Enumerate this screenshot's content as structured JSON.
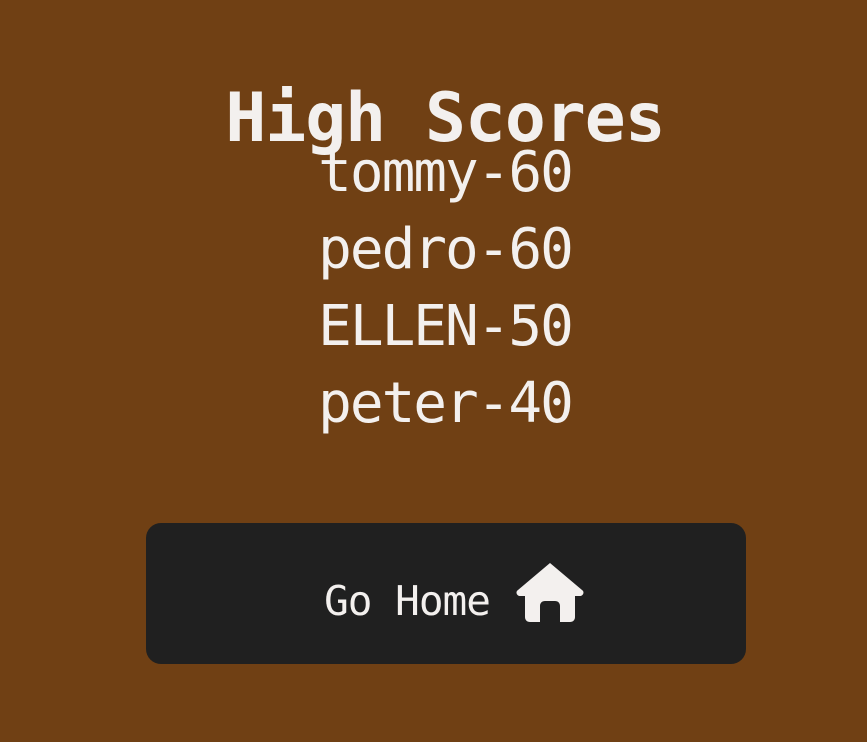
{
  "title": "High Scores",
  "scores": [
    "tommy-60",
    "pedro-60",
    "ELLEN-50",
    "peter-40"
  ],
  "home_button": {
    "label": "Go Home",
    "icon": "home-icon"
  },
  "colors": {
    "background": "#704014",
    "button": "#202020",
    "text": "#f3f0ee"
  }
}
